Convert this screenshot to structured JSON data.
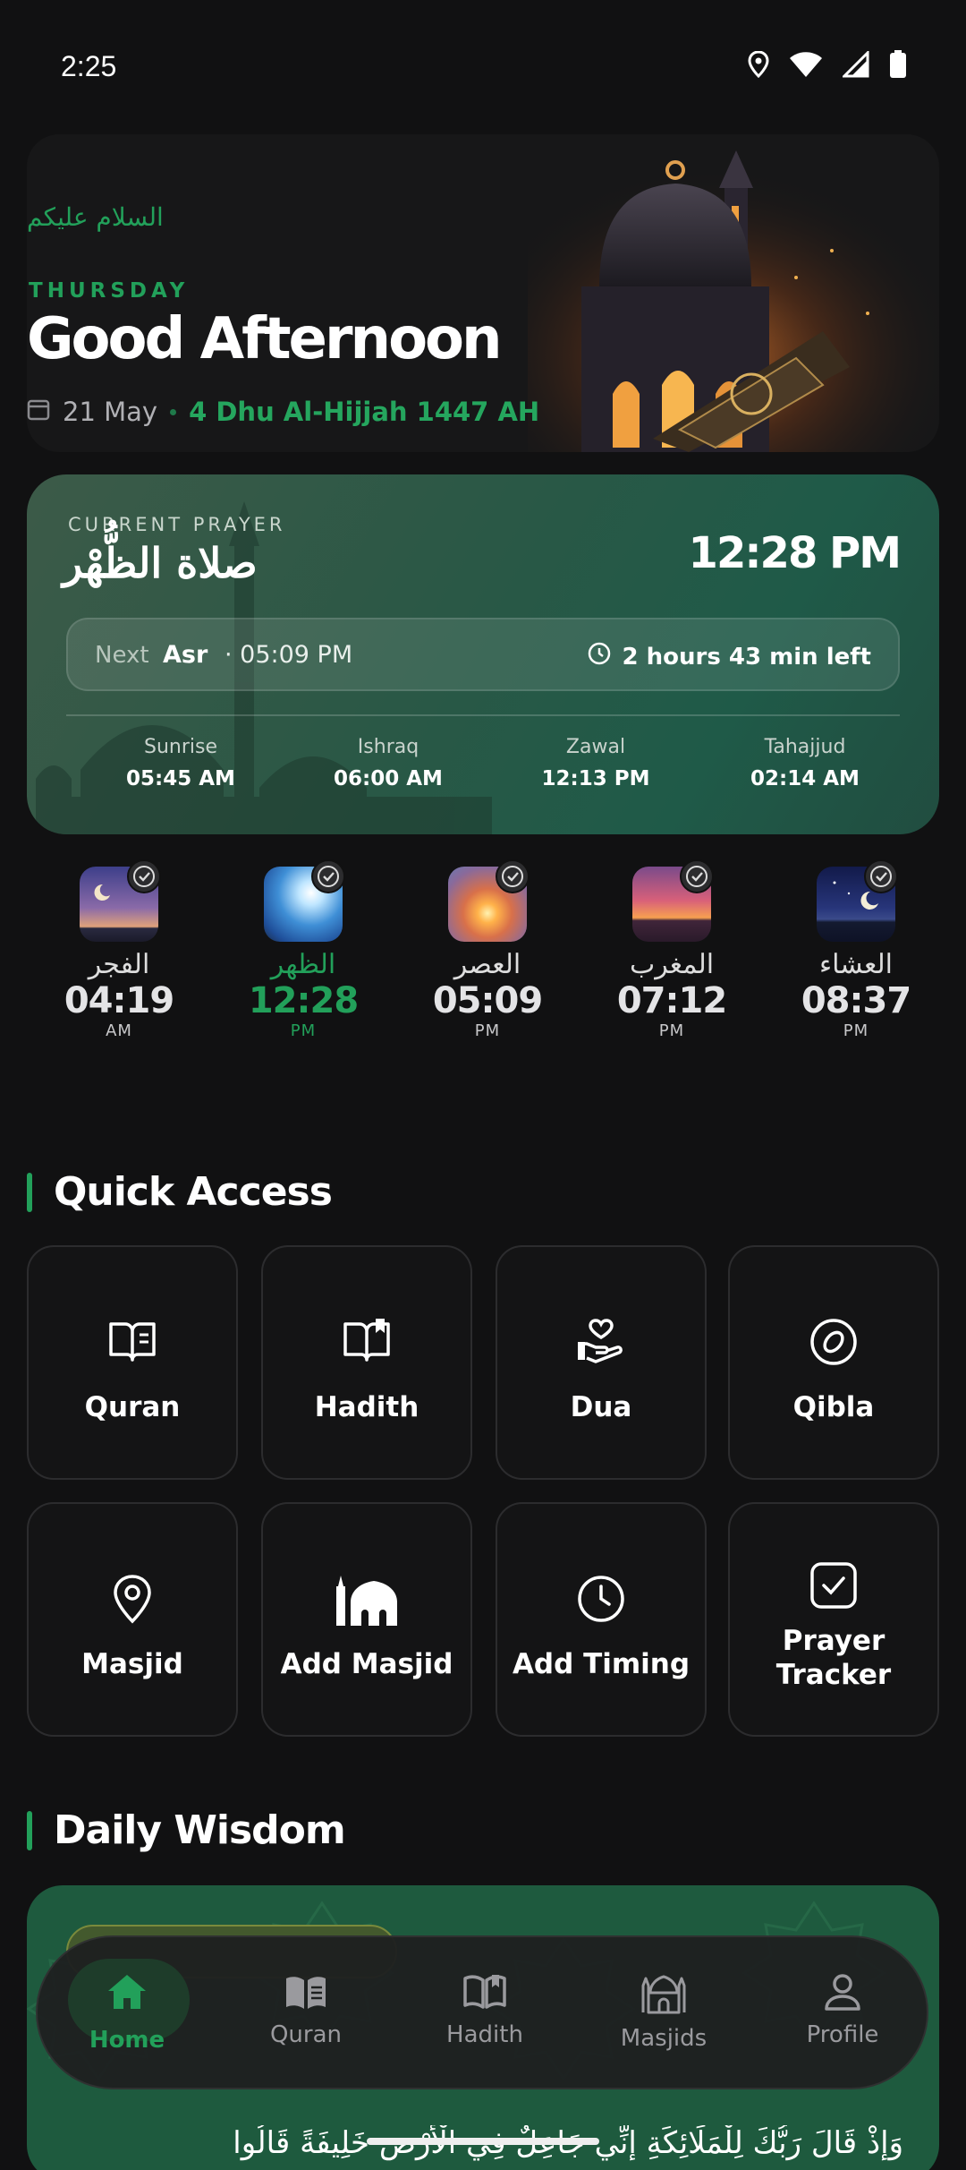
{
  "status": {
    "time": "2:25"
  },
  "hero": {
    "salam": "السلام عليكم",
    "weekday": "THURSDAY",
    "greeting": "Good Afternoon",
    "date": "21 May",
    "hijri": "4 Dhu Al-Hijjah 1447 AH"
  },
  "current": {
    "label": "CURRENT PRAYER",
    "arabic": "صلاة الظُّهْر",
    "time": "12:28 PM",
    "next_label": "Next",
    "next_name": "Asr",
    "next_time": "· 05:09 PM",
    "time_left": "2 hours 43 min left",
    "extras": [
      {
        "name": "Sunrise",
        "time": "05:45 AM"
      },
      {
        "name": "Ishraq",
        "time": "06:00 AM"
      },
      {
        "name": "Zawal",
        "time": "12:13 PM"
      },
      {
        "name": "Tahajjud",
        "time": "02:14 AM"
      }
    ]
  },
  "prayers": [
    {
      "arabic": "الفجر",
      "time": "04:19",
      "ampm": "AM"
    },
    {
      "arabic": "الظهر",
      "time": "12:28",
      "ampm": "PM"
    },
    {
      "arabic": "العصر",
      "time": "05:09",
      "ampm": "PM"
    },
    {
      "arabic": "المغرب",
      "time": "07:12",
      "ampm": "PM"
    },
    {
      "arabic": "العشاء",
      "time": "08:37",
      "ampm": "PM"
    }
  ],
  "quick_access": {
    "title": "Quick Access",
    "tiles": [
      {
        "label": "Quran",
        "icon": "book-open-icon"
      },
      {
        "label": "Hadith",
        "icon": "book-bookmark-icon"
      },
      {
        "label": "Dua",
        "icon": "hand-heart-icon"
      },
      {
        "label": "Qibla",
        "icon": "compass-icon"
      },
      {
        "label": "Masjid",
        "icon": "map-pin-icon"
      },
      {
        "label": "Add Masjid",
        "icon": "mosque-icon"
      },
      {
        "label": "Add Timing",
        "icon": "clock-icon"
      },
      {
        "label": "Prayer Tracker",
        "icon": "checkbox-icon"
      }
    ]
  },
  "daily_wisdom": {
    "title": "Daily Wisdom",
    "text": "وَإِذْ قَالَ رَبُّكَ لِلْمَلَائِكَةِ إِنِّي جَاعِلٌ فِي الْأَرْضِ خَلِيفَةً قَالُوا"
  },
  "nav": [
    {
      "label": "Home",
      "icon": "home-icon"
    },
    {
      "label": "Quran",
      "icon": "quran-icon"
    },
    {
      "label": "Hadith",
      "icon": "hadith-icon"
    },
    {
      "label": "Masjids",
      "icon": "masjid-icon"
    },
    {
      "label": "Profile",
      "icon": "profile-icon"
    }
  ],
  "colors": {
    "accent": "#22a05a",
    "background": "#111112",
    "card": "#2a5846"
  }
}
